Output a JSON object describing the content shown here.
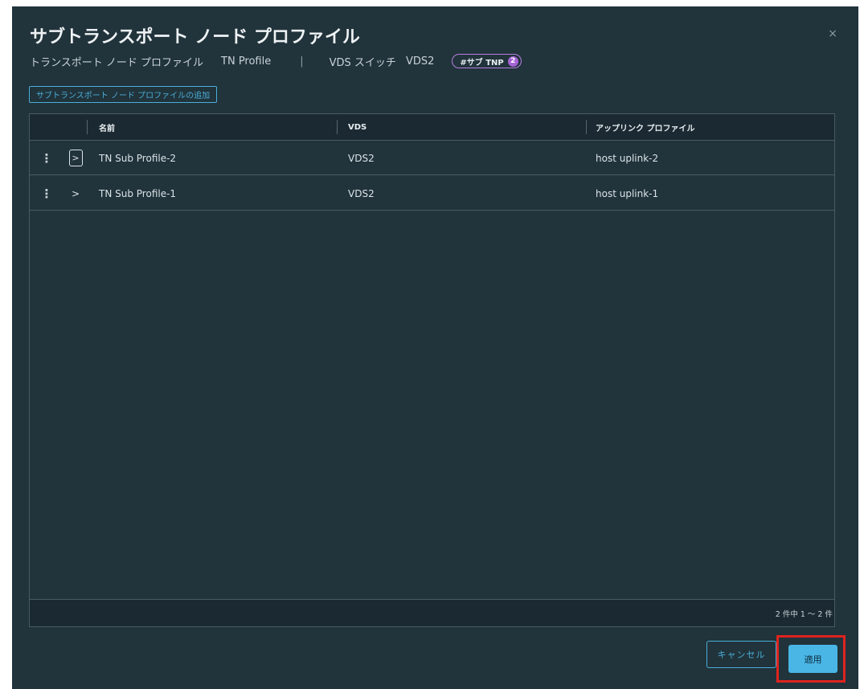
{
  "dialog": {
    "title": "サブトランスポート ノード プロファイル",
    "close_label": "×"
  },
  "subheader": {
    "tnp_label": "トランスポート ノード プロファイル",
    "tnp_value": "TN Profile",
    "separator": "|",
    "vds_label": "VDS スイッチ",
    "vds_value": "VDS2",
    "badge_label": "#サブ TNP",
    "badge_count": "2"
  },
  "toolbar": {
    "add_label": "サブトランスポート ノード プロファイルの追加"
  },
  "table": {
    "columns": [
      "名前",
      "VDS",
      "アップリンク プロファイル"
    ],
    "rows": [
      {
        "name": "TN Sub Profile-2",
        "vds": "VDS2",
        "uplink": "host uplink-2",
        "kebab": "⋮",
        "expand": ">"
      },
      {
        "name": "TN Sub Profile-1",
        "vds": "VDS2",
        "uplink": "host uplink-1",
        "kebab": "⋮",
        "expand": ">"
      }
    ],
    "footer_count": "2 件中 1 ～ 2 件"
  },
  "footer": {
    "cancel_label": "キャンセル",
    "apply_label": "適用"
  },
  "colors": {
    "dialog_bg": "#21333b",
    "accent": "#49afd9",
    "badge": "#b67fe0",
    "highlight": "#e0231f"
  }
}
